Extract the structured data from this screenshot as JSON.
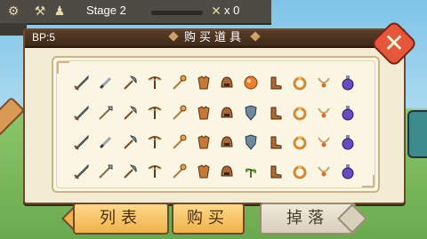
{
  "hud": {
    "stage_label": "Stage 2",
    "tools_count": "x 0",
    "icons": [
      "gear-icon",
      "pickaxe-icon",
      "character-icon",
      "crossed-tools-icon"
    ]
  },
  "dialog": {
    "bp": "BP:5",
    "title": "购买道具",
    "close_icon": "close-x-icon"
  },
  "tabs": [
    {
      "label": "列表",
      "active": false
    },
    {
      "label": "购买",
      "active": true
    },
    {
      "label": "掉落",
      "active": false
    }
  ],
  "items": [
    [
      "sword-icon",
      "dagger-icon",
      "axe-icon",
      "crossbow-icon",
      "wand-icon",
      "armor-icon",
      "helmet-icon",
      "orb-icon",
      "boots-icon",
      "ring-icon",
      "necklace-icon",
      "potion-icon"
    ],
    [
      "sword-icon",
      "spear-icon",
      "axe-icon",
      "crossbow-icon",
      "wand-icon",
      "armor-icon",
      "helmet-icon",
      "shield-icon",
      "boots-icon",
      "ring-icon",
      "necklace-icon",
      "potion-icon"
    ],
    [
      "sword-icon",
      "dagger-icon",
      "axe-icon",
      "crossbow-icon",
      "wand-icon",
      "armor-icon",
      "helmet-icon",
      "shield-icon",
      "boots-icon",
      "ring-icon",
      "necklace-icon",
      "potion-icon"
    ],
    [
      "sword-icon",
      "spear-icon",
      "axe-icon",
      "crossbow-icon",
      "wand-icon",
      "armor-icon",
      "helmet-icon",
      "herb-icon",
      "boots-icon",
      "ring-icon",
      "necklace-icon",
      "potion-icon"
    ]
  ],
  "colors": {
    "header_bg": "#4a3220",
    "panel_bg": "#f4ebd5",
    "close_red": "#e4573b",
    "tab_gold": "#f0b14a",
    "tab_inactive": "#d8cfbc"
  }
}
